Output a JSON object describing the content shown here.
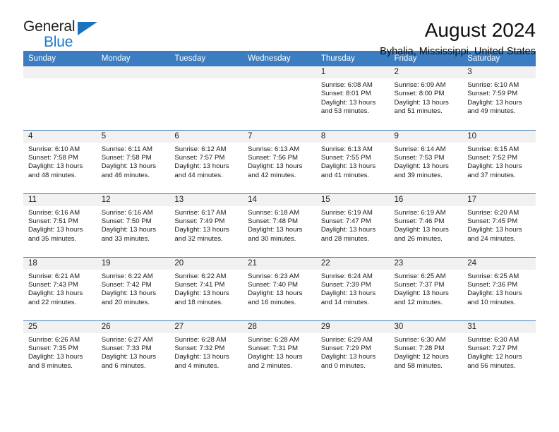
{
  "brand": {
    "name_part1": "General",
    "name_part2": "Blue",
    "triangle_color": "#1b72bd"
  },
  "header": {
    "month_title": "August 2024",
    "location": "Byhalia, Mississippi, United States",
    "accent_color": "#3b7dc0"
  },
  "calendar": {
    "weekday_headers": [
      "Sunday",
      "Monday",
      "Tuesday",
      "Wednesday",
      "Thursday",
      "Friday",
      "Saturday"
    ],
    "labels": {
      "sunrise_prefix": "Sunrise:",
      "sunset_prefix": "Sunset:",
      "daylight_prefix": "Daylight:"
    },
    "weeks": [
      [
        {
          "day": "",
          "empty": true
        },
        {
          "day": "",
          "empty": true
        },
        {
          "day": "",
          "empty": true
        },
        {
          "day": "",
          "empty": true
        },
        {
          "day": "1",
          "sunrise": "Sunrise: 6:08 AM",
          "sunset": "Sunset: 8:01 PM",
          "daylight_line1": "Daylight: 13 hours",
          "daylight_line2": "and 53 minutes."
        },
        {
          "day": "2",
          "sunrise": "Sunrise: 6:09 AM",
          "sunset": "Sunset: 8:00 PM",
          "daylight_line1": "Daylight: 13 hours",
          "daylight_line2": "and 51 minutes."
        },
        {
          "day": "3",
          "sunrise": "Sunrise: 6:10 AM",
          "sunset": "Sunset: 7:59 PM",
          "daylight_line1": "Daylight: 13 hours",
          "daylight_line2": "and 49 minutes."
        }
      ],
      [
        {
          "day": "4",
          "sunrise": "Sunrise: 6:10 AM",
          "sunset": "Sunset: 7:58 PM",
          "daylight_line1": "Daylight: 13 hours",
          "daylight_line2": "and 48 minutes."
        },
        {
          "day": "5",
          "sunrise": "Sunrise: 6:11 AM",
          "sunset": "Sunset: 7:58 PM",
          "daylight_line1": "Daylight: 13 hours",
          "daylight_line2": "and 46 minutes."
        },
        {
          "day": "6",
          "sunrise": "Sunrise: 6:12 AM",
          "sunset": "Sunset: 7:57 PM",
          "daylight_line1": "Daylight: 13 hours",
          "daylight_line2": "and 44 minutes."
        },
        {
          "day": "7",
          "sunrise": "Sunrise: 6:13 AM",
          "sunset": "Sunset: 7:56 PM",
          "daylight_line1": "Daylight: 13 hours",
          "daylight_line2": "and 42 minutes."
        },
        {
          "day": "8",
          "sunrise": "Sunrise: 6:13 AM",
          "sunset": "Sunset: 7:55 PM",
          "daylight_line1": "Daylight: 13 hours",
          "daylight_line2": "and 41 minutes."
        },
        {
          "day": "9",
          "sunrise": "Sunrise: 6:14 AM",
          "sunset": "Sunset: 7:53 PM",
          "daylight_line1": "Daylight: 13 hours",
          "daylight_line2": "and 39 minutes."
        },
        {
          "day": "10",
          "sunrise": "Sunrise: 6:15 AM",
          "sunset": "Sunset: 7:52 PM",
          "daylight_line1": "Daylight: 13 hours",
          "daylight_line2": "and 37 minutes."
        }
      ],
      [
        {
          "day": "11",
          "sunrise": "Sunrise: 6:16 AM",
          "sunset": "Sunset: 7:51 PM",
          "daylight_line1": "Daylight: 13 hours",
          "daylight_line2": "and 35 minutes."
        },
        {
          "day": "12",
          "sunrise": "Sunrise: 6:16 AM",
          "sunset": "Sunset: 7:50 PM",
          "daylight_line1": "Daylight: 13 hours",
          "daylight_line2": "and 33 minutes."
        },
        {
          "day": "13",
          "sunrise": "Sunrise: 6:17 AM",
          "sunset": "Sunset: 7:49 PM",
          "daylight_line1": "Daylight: 13 hours",
          "daylight_line2": "and 32 minutes."
        },
        {
          "day": "14",
          "sunrise": "Sunrise: 6:18 AM",
          "sunset": "Sunset: 7:48 PM",
          "daylight_line1": "Daylight: 13 hours",
          "daylight_line2": "and 30 minutes."
        },
        {
          "day": "15",
          "sunrise": "Sunrise: 6:19 AM",
          "sunset": "Sunset: 7:47 PM",
          "daylight_line1": "Daylight: 13 hours",
          "daylight_line2": "and 28 minutes."
        },
        {
          "day": "16",
          "sunrise": "Sunrise: 6:19 AM",
          "sunset": "Sunset: 7:46 PM",
          "daylight_line1": "Daylight: 13 hours",
          "daylight_line2": "and 26 minutes."
        },
        {
          "day": "17",
          "sunrise": "Sunrise: 6:20 AM",
          "sunset": "Sunset: 7:45 PM",
          "daylight_line1": "Daylight: 13 hours",
          "daylight_line2": "and 24 minutes."
        }
      ],
      [
        {
          "day": "18",
          "sunrise": "Sunrise: 6:21 AM",
          "sunset": "Sunset: 7:43 PM",
          "daylight_line1": "Daylight: 13 hours",
          "daylight_line2": "and 22 minutes."
        },
        {
          "day": "19",
          "sunrise": "Sunrise: 6:22 AM",
          "sunset": "Sunset: 7:42 PM",
          "daylight_line1": "Daylight: 13 hours",
          "daylight_line2": "and 20 minutes."
        },
        {
          "day": "20",
          "sunrise": "Sunrise: 6:22 AM",
          "sunset": "Sunset: 7:41 PM",
          "daylight_line1": "Daylight: 13 hours",
          "daylight_line2": "and 18 minutes."
        },
        {
          "day": "21",
          "sunrise": "Sunrise: 6:23 AM",
          "sunset": "Sunset: 7:40 PM",
          "daylight_line1": "Daylight: 13 hours",
          "daylight_line2": "and 16 minutes."
        },
        {
          "day": "22",
          "sunrise": "Sunrise: 6:24 AM",
          "sunset": "Sunset: 7:39 PM",
          "daylight_line1": "Daylight: 13 hours",
          "daylight_line2": "and 14 minutes."
        },
        {
          "day": "23",
          "sunrise": "Sunrise: 6:25 AM",
          "sunset": "Sunset: 7:37 PM",
          "daylight_line1": "Daylight: 13 hours",
          "daylight_line2": "and 12 minutes."
        },
        {
          "day": "24",
          "sunrise": "Sunrise: 6:25 AM",
          "sunset": "Sunset: 7:36 PM",
          "daylight_line1": "Daylight: 13 hours",
          "daylight_line2": "and 10 minutes."
        }
      ],
      [
        {
          "day": "25",
          "sunrise": "Sunrise: 6:26 AM",
          "sunset": "Sunset: 7:35 PM",
          "daylight_line1": "Daylight: 13 hours",
          "daylight_line2": "and 8 minutes."
        },
        {
          "day": "26",
          "sunrise": "Sunrise: 6:27 AM",
          "sunset": "Sunset: 7:33 PM",
          "daylight_line1": "Daylight: 13 hours",
          "daylight_line2": "and 6 minutes."
        },
        {
          "day": "27",
          "sunrise": "Sunrise: 6:28 AM",
          "sunset": "Sunset: 7:32 PM",
          "daylight_line1": "Daylight: 13 hours",
          "daylight_line2": "and 4 minutes."
        },
        {
          "day": "28",
          "sunrise": "Sunrise: 6:28 AM",
          "sunset": "Sunset: 7:31 PM",
          "daylight_line1": "Daylight: 13 hours",
          "daylight_line2": "and 2 minutes."
        },
        {
          "day": "29",
          "sunrise": "Sunrise: 6:29 AM",
          "sunset": "Sunset: 7:29 PM",
          "daylight_line1": "Daylight: 13 hours",
          "daylight_line2": "and 0 minutes."
        },
        {
          "day": "30",
          "sunrise": "Sunrise: 6:30 AM",
          "sunset": "Sunset: 7:28 PM",
          "daylight_line1": "Daylight: 12 hours",
          "daylight_line2": "and 58 minutes."
        },
        {
          "day": "31",
          "sunrise": "Sunrise: 6:30 AM",
          "sunset": "Sunset: 7:27 PM",
          "daylight_line1": "Daylight: 12 hours",
          "daylight_line2": "and 56 minutes."
        }
      ]
    ]
  }
}
